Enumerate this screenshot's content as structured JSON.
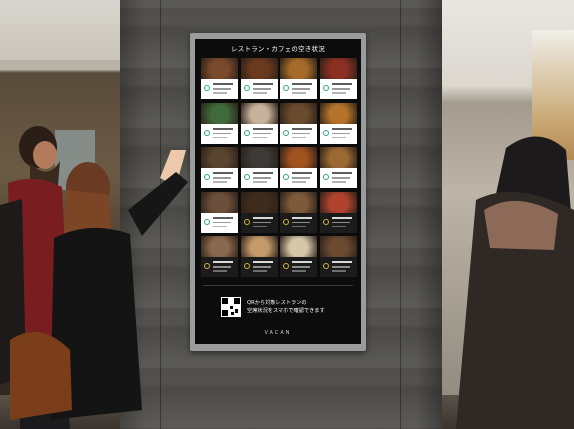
{
  "signage": {
    "title": "レストラン・カフェの空き状況",
    "qr_text_line1": "QRから対象レストランの",
    "qr_text_line2": "空席状況をスマホで確認できます",
    "fine_print": "",
    "brand": "VACAN"
  },
  "tiles": [
    {
      "img": "#7a4a2c",
      "status": "available"
    },
    {
      "img": "#6b3a1e",
      "status": "available"
    },
    {
      "img": "#a56a2a",
      "status": "available"
    },
    {
      "img": "#8a2f22",
      "status": "available"
    },
    {
      "img": "#3f6a3a",
      "status": "available"
    },
    {
      "img": "#c6b29a",
      "status": "available"
    },
    {
      "img": "#6a4b2e",
      "status": "available"
    },
    {
      "img": "#b5732a",
      "status": "available"
    },
    {
      "img": "#58442f",
      "status": "available"
    },
    {
      "img": "#3c3a36",
      "status": "available"
    },
    {
      "img": "#a0521f",
      "status": "available"
    },
    {
      "img": "#9b6a33",
      "status": "available"
    },
    {
      "img": "#6c4f3a",
      "status": "available"
    },
    {
      "img": "#402c1c",
      "status": "full"
    },
    {
      "img": "#7c5a3a",
      "status": "full"
    },
    {
      "img": "#b1432d",
      "status": "full"
    },
    {
      "img": "#8a6a4e",
      "status": "full"
    },
    {
      "img": "#c49a6a",
      "status": "full"
    },
    {
      "img": "#d5c7a8",
      "status": "full"
    },
    {
      "img": "#6b4a2f",
      "status": "full"
    }
  ],
  "colors": {
    "available_icon": "#2fa58e",
    "full_icon": "#d8b24a"
  }
}
